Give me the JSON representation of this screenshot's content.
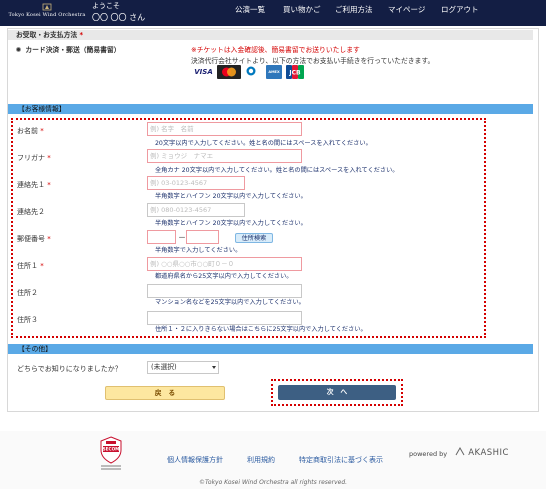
{
  "header": {
    "logo_text": "Tokyo Kosei Wind Orchestra",
    "welcome_label": "ようこそ",
    "user_name": "〇〇 〇〇 さん",
    "nav": [
      "公演一覧",
      "買い物かご",
      "ご利用方法",
      "マイページ",
      "ログアウト"
    ]
  },
  "payment": {
    "section_title": "お受取・お支払方法",
    "required_mark": "*",
    "option_label": "カード決済・郵送（簡易書留）",
    "note_red": "※チケットは入金確認後、簡易書留でお送りいたします",
    "note": "決済代行会社サイトより、以下の方法でお支払い手続きを行っていただきます。",
    "cards": [
      "VISA",
      "mastercard",
      "Diners Club",
      "AMEX",
      "JCB"
    ]
  },
  "customer": {
    "section_title": "【お客様情報】",
    "required_mark": "*",
    "fields": [
      {
        "label": "お名前",
        "required": true,
        "placeholder": "例) 名字　名前",
        "hint": "20文字以内で入力してください。姓と名の間にはスペースを入れてください。"
      },
      {
        "label": "フリガナ",
        "required": true,
        "placeholder": "例) ミョウジ　ナマエ",
        "hint": "全角カナ 20文字以内で入力してください。姓と名の間にはスペースを入れてください。"
      },
      {
        "label": "連絡先１",
        "required": true,
        "placeholder": "例) 03-0123-4567",
        "hint": "半角数字とハイフン 20文字以内で入力してください。"
      },
      {
        "label": "連絡先２",
        "required": false,
        "placeholder": "例) 080-0123-4567",
        "hint": "半角数字とハイフン 20文字以内で入力してください。"
      },
      {
        "label": "郵便番号",
        "required": true,
        "placeholder": "",
        "hint": "半角数字で入力してください。"
      },
      {
        "label": "住所１",
        "required": true,
        "placeholder": "例) ○○県○○市○○町０－０",
        "hint": "都道府県名から25文字以内で入力してください。"
      },
      {
        "label": "住所２",
        "required": false,
        "placeholder": "",
        "hint": "マンション名などを25文字以内で入力してください。"
      },
      {
        "label": "住所３",
        "required": false,
        "placeholder": "",
        "hint": "住所１・２に入りきらない場合はこちらに25文字以内で入力してください。"
      }
    ],
    "zip_separator": "－",
    "address_search_button": "住所検索"
  },
  "other": {
    "section_title": "【その他】",
    "question": "どちらでお知りになりましたか？",
    "select_value": "(未選択)"
  },
  "buttons": {
    "back": "戻　る",
    "next": "次　へ"
  },
  "footer": {
    "secom_text": "SECOM",
    "links": [
      "個人情報保護方針",
      "利用規約",
      "特定商取引法に基づく表示"
    ],
    "powered_by": "powered by",
    "akashic": "AKASHIC",
    "copyright": "©Tokyo Kosei Wind Orchestra all rights reserved."
  }
}
